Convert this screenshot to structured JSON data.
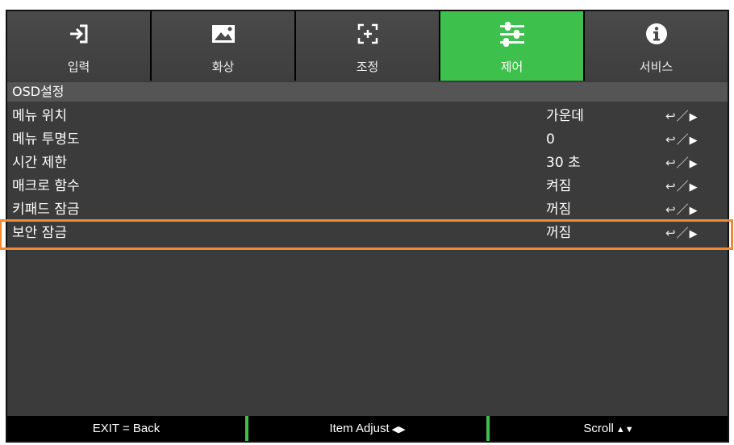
{
  "tabs": [
    {
      "label": "입력",
      "icon": "input-icon",
      "active": false
    },
    {
      "label": "화상",
      "icon": "image-icon",
      "active": false
    },
    {
      "label": "조정",
      "icon": "adjust-icon",
      "active": false
    },
    {
      "label": "제어",
      "icon": "sliders-icon",
      "active": true
    },
    {
      "label": "서비스",
      "icon": "info-icon",
      "active": false
    }
  ],
  "section": {
    "title": "OSD설정"
  },
  "rows": [
    {
      "name": "메뉴 위치",
      "value": "가운데"
    },
    {
      "name": "메뉴 투명도",
      "value": "0"
    },
    {
      "name": "시간 제한",
      "value": "30 초"
    },
    {
      "name": "매크로 함수",
      "value": "켜짐"
    },
    {
      "name": "키패드 잠금",
      "value": "꺼짐"
    },
    {
      "name": "보안 잠금",
      "value": "꺼짐",
      "selected": true
    }
  ],
  "row_control": {
    "enter_glyph": "↩",
    "slash": "／",
    "arrow": "▶"
  },
  "footer": {
    "exit": "EXIT = Back",
    "adjust": "Item Adjust",
    "adjust_arrows": "◀▶",
    "scroll": "Scroll",
    "scroll_arrows": "▲▼"
  },
  "colors": {
    "accent": "#3ec04d",
    "highlight": "#f08a33",
    "panel": "#3b3b3b"
  }
}
